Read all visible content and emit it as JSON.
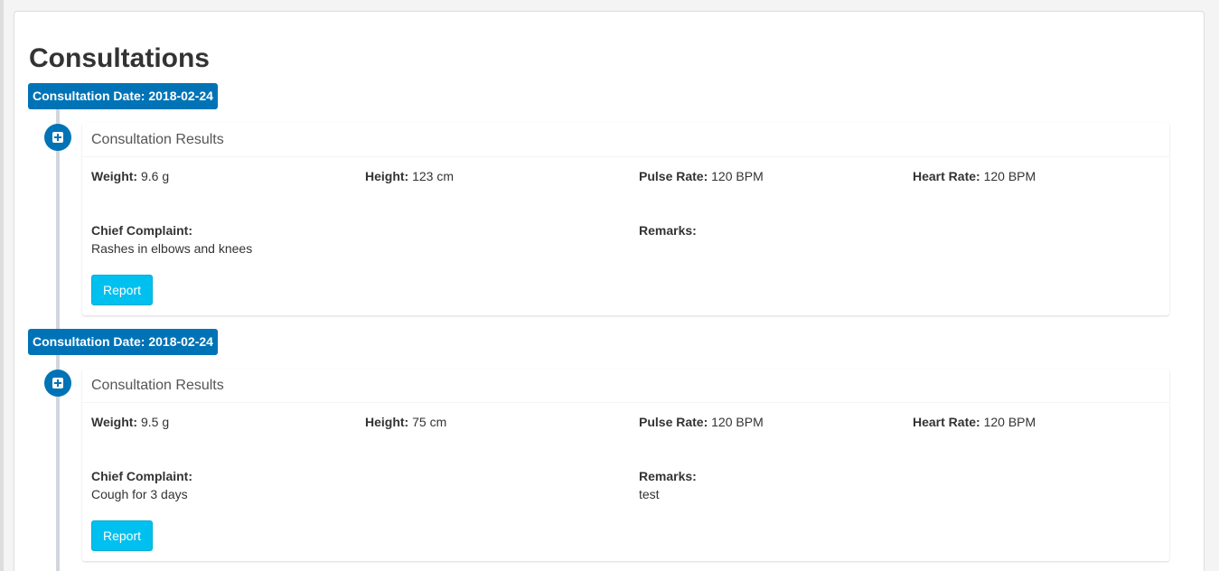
{
  "page": {
    "title": "Consultations"
  },
  "consultations": [
    {
      "date_label": "Consultation Date: 2018-02-24",
      "icon": "plus-square-icon",
      "header": "Consultation Results",
      "weight_label": "Weight:",
      "weight_value": "9.6 g",
      "height_label": "Height:",
      "height_value": "123 cm",
      "pulse_label": "Pulse Rate:",
      "pulse_value": "120 BPM",
      "heart_label": "Heart Rate:",
      "heart_value": "120 BPM",
      "complaint_label": "Chief Complaint:",
      "complaint_value": "Rashes in elbows and knees",
      "remarks_label": "Remarks:",
      "remarks_value": "",
      "report_label": "Report"
    },
    {
      "date_label": "Consultation Date: 2018-02-24",
      "icon": "plus-square-icon",
      "header": "Consultation Results",
      "weight_label": "Weight:",
      "weight_value": "9.5 g",
      "height_label": "Height:",
      "height_value": "75 cm",
      "pulse_label": "Pulse Rate:",
      "pulse_value": "120 BPM",
      "heart_label": "Heart Rate:",
      "heart_value": "120 BPM",
      "complaint_label": "Chief Complaint:",
      "complaint_value": "Cough for 3 days",
      "remarks_label": "Remarks:",
      "remarks_value": "test",
      "report_label": "Report"
    }
  ],
  "colors": {
    "primary": "#0073b7",
    "info_button": "#00c0ef",
    "timeline_line": "#d2d6de"
  }
}
